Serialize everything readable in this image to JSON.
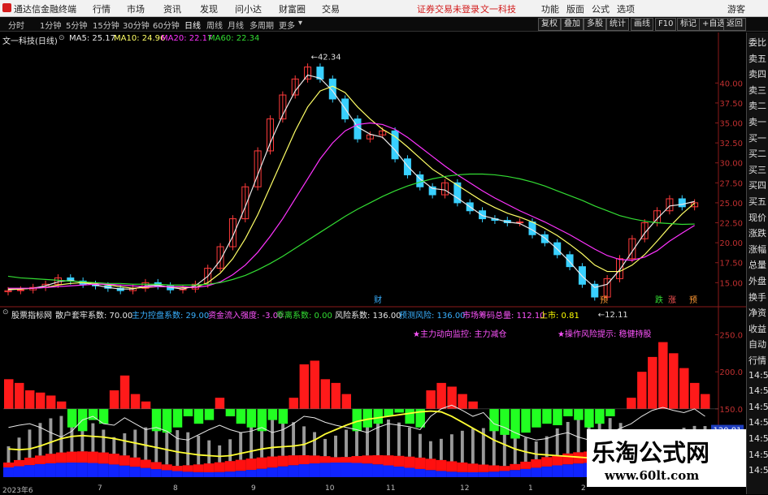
{
  "titlebar": {
    "app_name": "通达信金融终端",
    "menus": [
      "行情",
      "市场",
      "资讯",
      "发现",
      "问小达",
      "财富圈",
      "交易"
    ],
    "notice": "证券交易未登录",
    "stock_name": "文一科技",
    "right_menus": [
      "功能",
      "版面",
      "公式",
      "选项"
    ],
    "user": "游客"
  },
  "periods": {
    "items": [
      "分时",
      "1分钟",
      "5分钟",
      "15分钟",
      "30分钟",
      "60分钟",
      "日线",
      "周线",
      "月线",
      "多周期",
      "更多"
    ],
    "selected": "日线",
    "tools": [
      "复权",
      "叠加",
      "多股",
      "统计",
      "画线",
      "F10",
      "标记",
      "+自选",
      "返回"
    ]
  },
  "ma_legend": {
    "title": "文一科技(日线)",
    "ma5": "MA5: 25.17",
    "ma10": "MA10: 24.96",
    "ma20": "MA20: 22.17",
    "ma60": "MA60: 22.34"
  },
  "right_panel": [
    "委比",
    "卖五",
    "卖四",
    "卖三",
    "卖二",
    "卖一",
    "买一",
    "买二",
    "买三",
    "买四",
    "买五",
    "现价",
    "涨跌",
    "涨幅",
    "总量",
    "外盘",
    "换手",
    "净资",
    "收益",
    "自动",
    "行情",
    "14:5",
    "14:5",
    "14:5",
    "14:5",
    "14:5",
    "14:5",
    "14:5"
  ],
  "indicator_header": {
    "name": "股票指标网",
    "items": [
      {
        "label": "散户套牢系数: 70.00",
        "color": "#e8e8e8"
      },
      {
        "label": "主力控盘系数: 29.00",
        "color": "#39b0ff"
      },
      {
        "label": "资金流入强度: -3.00",
        "color": "#ff55ff"
      },
      {
        "label": "乖离系数: 0.00",
        "color": "#33dd33"
      },
      {
        "label": "风险系数: 136.00",
        "color": "#e8e8e8"
      },
      {
        "label": "预测风险: 136.00",
        "color": "#39b0ff"
      },
      {
        "label": "市场筹码总量: 112.10",
        "color": "#ff55ff"
      },
      {
        "label": "上市: 0.81",
        "color": "#ffff00"
      }
    ],
    "note1": "★主力动向监控: 主力减仓",
    "note2": "★操作风险提示: 稳健持股"
  },
  "events": [
    {
      "label": "财",
      "color": "#39b0ff"
    },
    {
      "label": "预",
      "color": "#ff9933"
    },
    {
      "label": "跌",
      "color": "#33dd33"
    },
    {
      "label": "涨",
      "color": "#ff5555"
    },
    {
      "label": "预",
      "color": "#ff9933"
    }
  ],
  "price_badge": "120.81",
  "date_axis": [
    "2023年6",
    "7",
    "8",
    "9",
    "10",
    "11",
    "12",
    "1",
    "2"
  ],
  "watermark": {
    "line1": "乐淘公式网",
    "line2": "www.60lt.com"
  },
  "chart_data": [
    {
      "type": "candlestick",
      "title": "文一科技(日线)",
      "y_ticks": [
        40.0,
        37.5,
        35.0,
        32.5,
        30.0,
        27.5,
        25.0,
        22.5,
        20.0,
        17.5,
        15.0
      ],
      "ylim": [
        13.0,
        44.5
      ],
      "annotations": [
        {
          "label": "42.34",
          "value": 42.34
        },
        {
          "label": "12.11",
          "value": 12.11
        }
      ],
      "x_sample_close": [
        14.0,
        14.1,
        14.4,
        14.8,
        15.6,
        15.2,
        14.8,
        14.6,
        14.3,
        14.0,
        14.3,
        15.0,
        14.6,
        14.1,
        14.2,
        14.8,
        16.8,
        19.5,
        23.0,
        27.0,
        31.5,
        35.5,
        38.5,
        40.5,
        42.0,
        40.5,
        38.0,
        35.5,
        33.0,
        33.5,
        34.0,
        30.5,
        28.5,
        27.0,
        26.0,
        27.5,
        25.0,
        24.0,
        23.0,
        22.8,
        22.5,
        22.6,
        21.0,
        20.0,
        18.5,
        17.0,
        14.8,
        13.2,
        15.5,
        18.0,
        20.5,
        22.5,
        24.0,
        25.5,
        24.5,
        25.0
      ],
      "series": [
        {
          "name": "MA5",
          "color": "#e8e8e8",
          "values": [
            14.1,
            14.2,
            14.3,
            14.6,
            15.1,
            15.3,
            15.0,
            14.7,
            14.4,
            14.2,
            14.2,
            14.6,
            14.7,
            14.4,
            14.2,
            14.6,
            15.8,
            17.8,
            20.8,
            24.5,
            28.5,
            32.5,
            36.0,
            39.0,
            41.0,
            40.6,
            39.0,
            36.8,
            34.5,
            33.6,
            33.2,
            31.6,
            29.6,
            28.0,
            26.8,
            26.6,
            25.6,
            24.5,
            23.4,
            23.0,
            22.6,
            22.4,
            21.6,
            20.6,
            19.2,
            17.6,
            15.8,
            14.4,
            14.8,
            16.6,
            18.9,
            21.2,
            23.0,
            24.6,
            24.8,
            25.17
          ]
        },
        {
          "name": "MA10",
          "color": "#ffff66",
          "values": [
            14.2,
            14.2,
            14.3,
            14.4,
            14.7,
            14.9,
            15.0,
            14.9,
            14.7,
            14.5,
            14.3,
            14.4,
            14.5,
            14.5,
            14.4,
            14.4,
            15.0,
            16.2,
            18.0,
            20.5,
            23.5,
            27.0,
            30.5,
            34.0,
            37.0,
            39.0,
            39.6,
            38.8,
            37.0,
            35.5,
            34.2,
            33.3,
            32.0,
            30.6,
            29.2,
            28.2,
            27.2,
            26.2,
            25.2,
            24.4,
            23.7,
            23.2,
            22.6,
            21.8,
            20.9,
            19.8,
            18.6,
            17.2,
            16.4,
            16.4,
            17.2,
            18.5,
            20.2,
            22.0,
            23.6,
            24.96
          ]
        },
        {
          "name": "MA20",
          "color": "#ff33ff",
          "values": [
            14.3,
            14.3,
            14.3,
            14.4,
            14.5,
            14.6,
            14.7,
            14.8,
            14.8,
            14.7,
            14.6,
            14.5,
            14.5,
            14.5,
            14.5,
            14.4,
            14.6,
            15.1,
            16.0,
            17.2,
            18.8,
            20.8,
            23.0,
            25.5,
            28.0,
            30.5,
            32.5,
            34.0,
            34.8,
            35.0,
            34.8,
            34.2,
            33.2,
            32.0,
            30.8,
            29.6,
            28.5,
            27.5,
            26.5,
            25.6,
            24.8,
            24.0,
            23.3,
            22.6,
            21.8,
            21.0,
            20.1,
            19.2,
            18.4,
            17.9,
            17.8,
            18.2,
            19.0,
            20.2,
            21.2,
            22.17
          ]
        },
        {
          "name": "MA60",
          "color": "#33dd33",
          "values": [
            15.8,
            15.6,
            15.5,
            15.4,
            15.3,
            15.2,
            15.1,
            15.0,
            14.9,
            14.9,
            14.8,
            14.8,
            14.8,
            14.7,
            14.7,
            14.7,
            14.8,
            15.0,
            15.4,
            15.9,
            16.6,
            17.4,
            18.3,
            19.3,
            20.3,
            21.3,
            22.3,
            23.3,
            24.2,
            25.0,
            25.8,
            26.5,
            27.1,
            27.6,
            28.0,
            28.3,
            28.5,
            28.6,
            28.6,
            28.5,
            28.3,
            28.0,
            27.6,
            27.1,
            26.5,
            25.9,
            25.3,
            24.6,
            24.0,
            23.4,
            23.0,
            22.7,
            22.5,
            22.4,
            22.3,
            22.34
          ]
        }
      ]
    },
    {
      "type": "bar",
      "title": "股票指标网",
      "y_ticks": [
        250.0,
        200.0,
        150.0,
        100.0
      ],
      "ylim": [
        58,
        268
      ],
      "baseline": 150,
      "values": [
        190,
        185,
        175,
        172,
        168,
        160,
        125,
        120,
        135,
        130,
        175,
        195,
        170,
        160,
        120,
        118,
        125,
        140,
        130,
        135,
        165,
        140,
        130,
        125,
        120,
        135,
        130,
        165,
        210,
        215,
        190,
        185,
        170,
        120,
        125,
        130,
        140,
        145,
        130,
        125,
        175,
        185,
        180,
        170,
        160,
        150,
        120,
        115,
        110,
        118,
        125,
        130,
        128,
        140,
        135,
        125,
        130,
        140,
        150,
        165,
        200,
        220,
        240,
        225,
        205,
        185,
        170
      ],
      "series": [
        {
          "name": "散户套牢系数",
          "color": "#e8e8e8",
          "values": [
            125,
            128,
            130,
            125,
            118,
            112,
            120,
            135,
            140,
            130,
            128,
            138,
            130,
            122,
            125,
            120,
            110,
            108,
            115,
            122,
            128,
            122,
            118,
            120,
            125,
            118,
            122,
            130,
            140,
            138,
            132,
            128,
            125,
            122,
            118,
            125,
            130,
            128,
            126,
            122,
            140,
            150,
            155,
            148,
            140,
            145,
            130,
            125,
            118,
            112,
            108,
            110,
            115,
            118,
            112,
            108,
            112,
            118,
            124,
            130,
            140,
            148,
            152,
            148,
            145,
            150,
            140
          ]
        },
        {
          "name": "主力控盘系数",
          "color": "#ffff33",
          "values": [
            96,
            95,
            96,
            100,
            105,
            110,
            113,
            114,
            113,
            112,
            110,
            107,
            104,
            101,
            98,
            95,
            92,
            90,
            88,
            87,
            86,
            87,
            90,
            93,
            96,
            98,
            99,
            100,
            102,
            108,
            116,
            122,
            128,
            133,
            136,
            138,
            140,
            142,
            144,
            146,
            147,
            146,
            140,
            132,
            124,
            116,
            108,
            102,
            96,
            92,
            89,
            88,
            87,
            86,
            85,
            84,
            84,
            85,
            86,
            88,
            91,
            95,
            100,
            106,
            112,
            118,
            121
          ]
        }
      ]
    }
  ]
}
